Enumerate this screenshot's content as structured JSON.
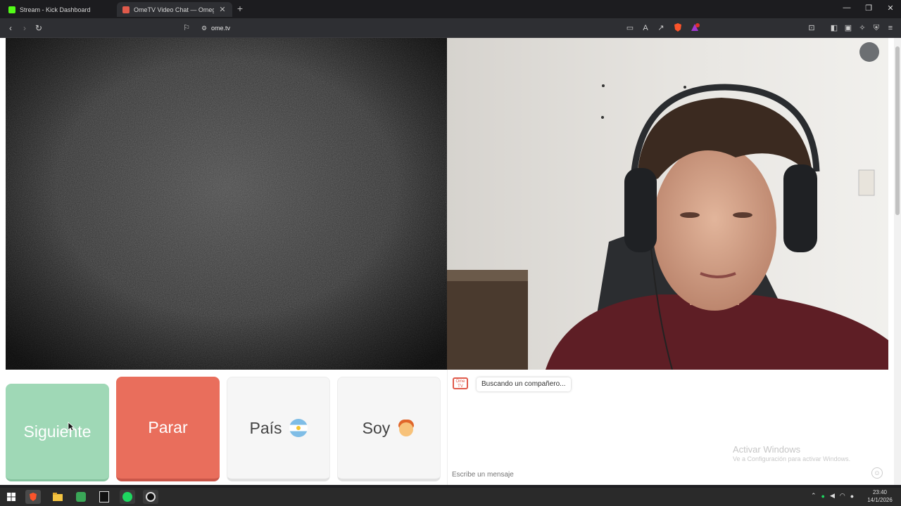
{
  "browser": {
    "tabs": [
      {
        "title": "Stream - Kick Dashboard",
        "favicon_color": "#53fc18"
      },
      {
        "title": "OmeTV Video Chat — Omegl",
        "favicon_color": "#e05a4b"
      }
    ],
    "new_tab": "+",
    "url": "ome.tv",
    "window_controls": {
      "minimize": "—",
      "restore": "❐",
      "close": "✕"
    }
  },
  "controls": {
    "next_label": "Siguiente",
    "stop_label": "Parar",
    "country_label": "País",
    "me_label": "Soy"
  },
  "chat": {
    "logo_text": "Ome TV",
    "status_message": "Buscando un compañero...",
    "input_placeholder": "Escribe un mensaje"
  },
  "windows_watermark": {
    "title": "Activar Windows",
    "subtitle": "Ve a Configuración para activar Windows."
  },
  "taskbar": {
    "clock_time": "23:40",
    "clock_date": "14/1/2026",
    "items": [
      "start-icon",
      "brave-icon",
      "file-explorer-icon",
      "app-icon",
      "epic-games-icon",
      "spotify-icon",
      "obs-icon"
    ]
  },
  "colors": {
    "next": "#9fd8b6",
    "stop": "#e96e5c",
    "neutral": "#f6f6f6",
    "brand": "#e05a4b"
  }
}
